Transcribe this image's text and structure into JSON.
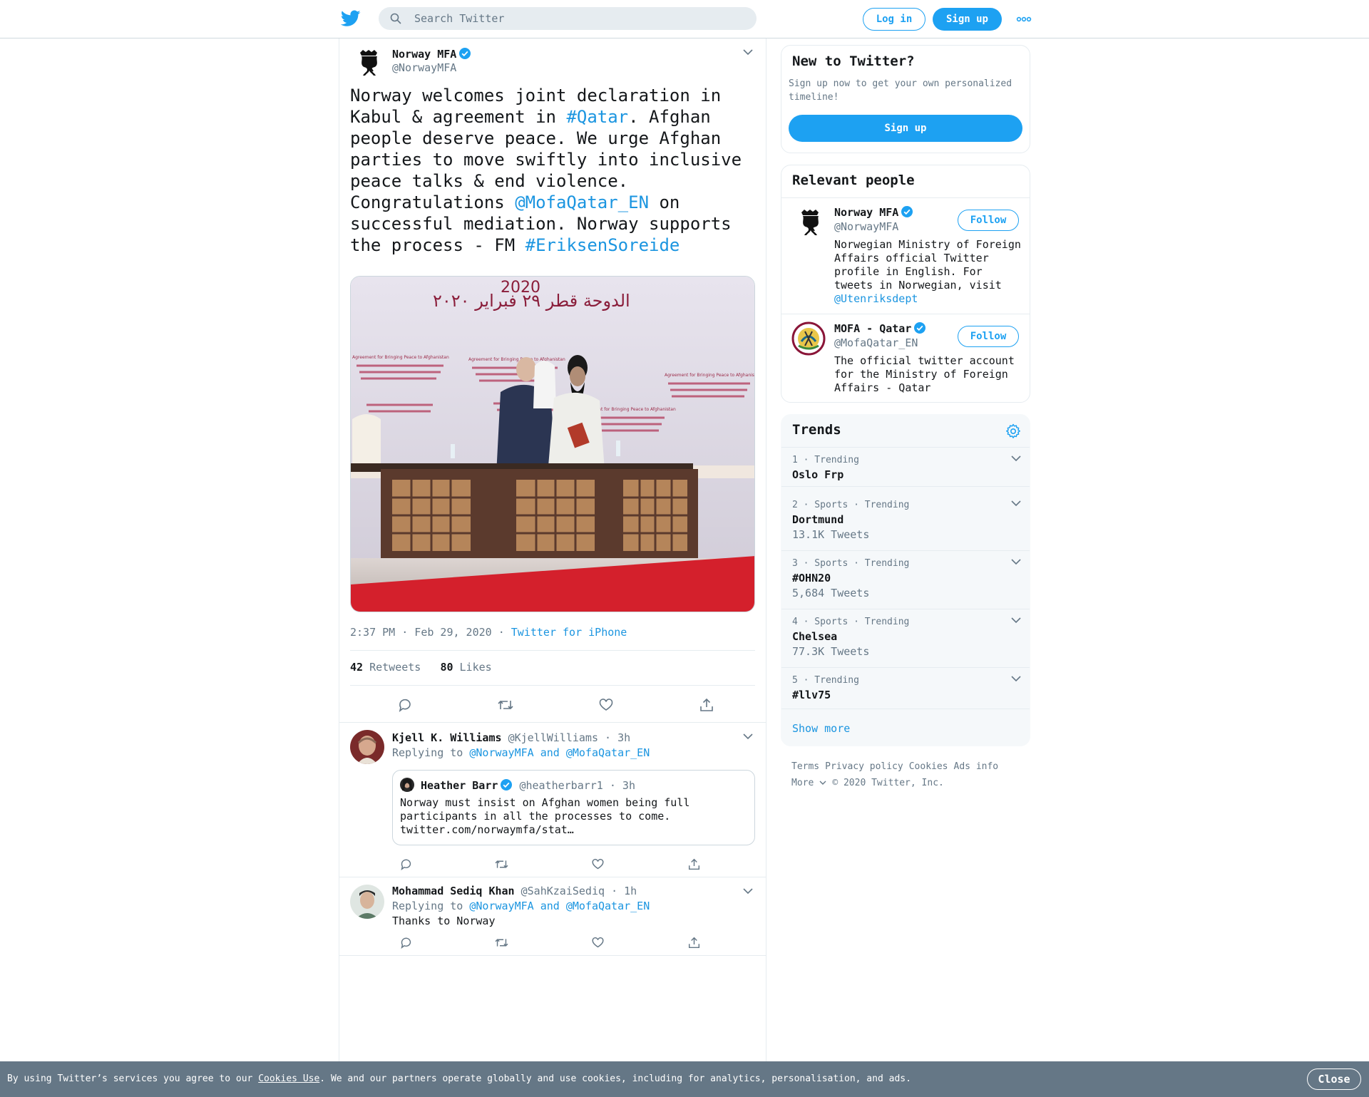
{
  "header": {
    "search_placeholder": "Search Twitter",
    "login_label": "Log in",
    "signup_label": "Sign up",
    "brand_color": "#1DA1F2"
  },
  "tweet": {
    "author_name": "Norway MFA",
    "author_handle": "@NorwayMFA",
    "text_parts": [
      "Norway welcomes joint declaration in Kabul & agreement in ",
      "#Qatar",
      ". Afghan people deserve peace. We urge Afghan parties to move swiftly into inclusive peace talks & end violence. Congratulations ",
      "@MofaQatar_EN",
      " on successful mediation. Norway supports the process - FM ",
      "#EriksenSoreide"
    ],
    "time": "2:37 PM · Feb 29, 2020",
    "source": "Twitter for iPhone",
    "retweets": "42",
    "retweets_label": "Retweets",
    "likes": "80",
    "likes_label": "Likes",
    "media_banner_text": "الدوحة قطر ٢٩ فبراير ٢٠٢٠",
    "media_banner_year": "2020",
    "media_poster_text": "Agreement for Bringing Peace to Afghanistan"
  },
  "replies": [
    {
      "name": "Kjell K. Williams",
      "handle": "@KjellWilliams",
      "time": "· 3h",
      "replying_prefix": "Replying to ",
      "replying_to": "@NorwayMFA and @MofaQatar_EN",
      "quote": {
        "name": "Heather Barr",
        "handle": "@heatherbarr1",
        "time": "· 3h",
        "text": "Norway must insist on Afghan women being full participants in all the processes to come. twitter.com/norwaymfa/stat…"
      }
    },
    {
      "name": "Mohammad Sediq Khan",
      "handle": "@SahKzaiSediq",
      "time": "· 1h",
      "replying_prefix": "Replying to ",
      "replying_to": "@NorwayMFA and @MofaQatar_EN",
      "text": "Thanks to Norway"
    }
  ],
  "sidebar": {
    "new_title": "New to Twitter?",
    "new_subtitle": "Sign up now to get your own personalized timeline!",
    "new_signup_label": "Sign up",
    "people_title": "Relevant people",
    "follow_label": "Follow",
    "people": [
      {
        "name": "Norway MFA",
        "handle": "@NorwayMFA",
        "bio": "Norwegian Ministry of Foreign Affairs official Twitter profile in English. For tweets in Norwegian, visit ",
        "bio_link": "@Utenriksdept"
      },
      {
        "name": "MOFA - Qatar",
        "handle": "@MofaQatar_EN",
        "bio": "The official twitter account for the Ministry of Foreign Affairs - Qatar",
        "bio_link": ""
      }
    ],
    "trends_title": "Trends",
    "trends": [
      {
        "meta": "1 · Trending",
        "name": "Oslo Frp",
        "count": ""
      },
      {
        "meta": "2 · Sports · Trending",
        "name": "Dortmund",
        "count": "13.1K Tweets"
      },
      {
        "meta": "3 · Sports · Trending",
        "name": "#OHN20",
        "count": "5,684 Tweets"
      },
      {
        "meta": "4 · Sports · Trending",
        "name": "Chelsea",
        "count": "77.3K Tweets"
      },
      {
        "meta": "5 · Trending",
        "name": "#llv75",
        "count": ""
      }
    ],
    "show_more": "Show more",
    "footer": {
      "terms": "Terms",
      "privacy": "Privacy policy",
      "cookies": "Cookies",
      "ads": "Ads info",
      "more": "More",
      "copyright": "© 2020 Twitter, Inc."
    }
  },
  "cookie_bar": {
    "text_before": "By using Twitter’s services you agree to our ",
    "link": "Cookies Use",
    "text_after": ". We and our partners operate globally and use cookies, including for analytics, personalisation, and ads.",
    "close_label": "Close"
  }
}
